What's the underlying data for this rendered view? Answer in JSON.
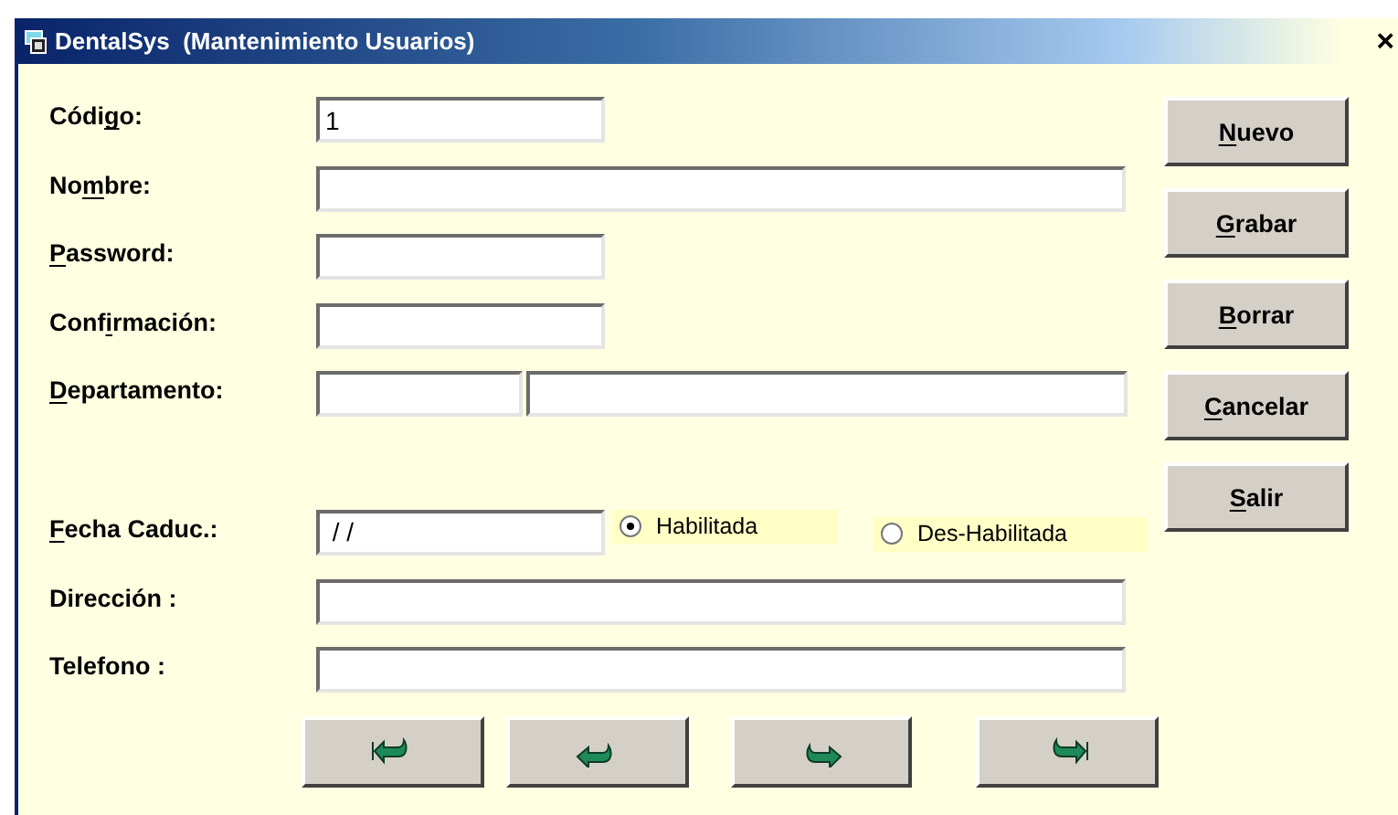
{
  "window": {
    "title": "DentalSys  (Mantenimiento Usuarios)",
    "close": "×"
  },
  "fields": [
    {
      "kind": "short",
      "label": [
        {
          "text": "Códi",
          "underlined": false
        },
        {
          "text": "g",
          "underlined": true
        },
        {
          "text": "o:",
          "underlined": false
        }
      ],
      "value": "1"
    },
    {
      "kind": "long",
      "label": [
        {
          "text": "No",
          "underlined": false
        },
        {
          "text": "m",
          "underlined": true
        },
        {
          "text": "bre:",
          "underlined": false
        }
      ]
    },
    {
      "kind": "short",
      "label": [
        {
          "text": "P",
          "underlined": true
        },
        {
          "text": "assword:",
          "underlined": false
        }
      ]
    },
    {
      "kind": "short",
      "label": [
        {
          "text": "Conf",
          "underlined": false
        },
        {
          "text": "i",
          "underlined": true
        },
        {
          "text": "rmación:",
          "underlined": false
        }
      ]
    },
    {
      "kind": "split",
      "label": [
        {
          "text": "D",
          "underlined": true
        },
        {
          "text": "epartamento:",
          "underlined": false
        }
      ]
    },
    {
      "kind": "gap"
    },
    {
      "kind": "short",
      "label": [
        {
          "text": "F",
          "underlined": true
        },
        {
          "text": "echa Caduc.:",
          "underlined": false
        }
      ],
      "value": " / /",
      "radios": [
        {
          "label": "Habilitada",
          "selected": true
        },
        {
          "label": "Des-Habilitada",
          "selected": false
        }
      ]
    },
    {
      "kind": "long",
      "label": [
        {
          "text": "Dirección :",
          "underlined": false
        }
      ]
    },
    {
      "kind": "long",
      "label": [
        {
          "text": "Telefono :",
          "underlined": false
        }
      ]
    }
  ],
  "buttons": [
    {
      "label": [
        {
          "text": "N",
          "underlined": true
        },
        {
          "text": "uevo",
          "underlined": false
        }
      ]
    },
    {
      "label": [
        {
          "text": "G",
          "underlined": true
        },
        {
          "text": "rabar",
          "underlined": false
        }
      ]
    },
    {
      "label": [
        {
          "text": "B",
          "underlined": true
        },
        {
          "text": "orrar",
          "underlined": false
        }
      ]
    },
    {
      "label": [
        {
          "text": "C",
          "underlined": true
        },
        {
          "text": "ancelar",
          "underlined": false
        }
      ]
    },
    {
      "label": [
        {
          "text": "S",
          "underlined": true
        },
        {
          "text": "alir",
          "underlined": false
        }
      ]
    }
  ],
  "nav_buttons": [
    {
      "kind": "first"
    },
    {
      "kind": "prev"
    },
    {
      "kind": "next"
    },
    {
      "kind": "last"
    }
  ]
}
